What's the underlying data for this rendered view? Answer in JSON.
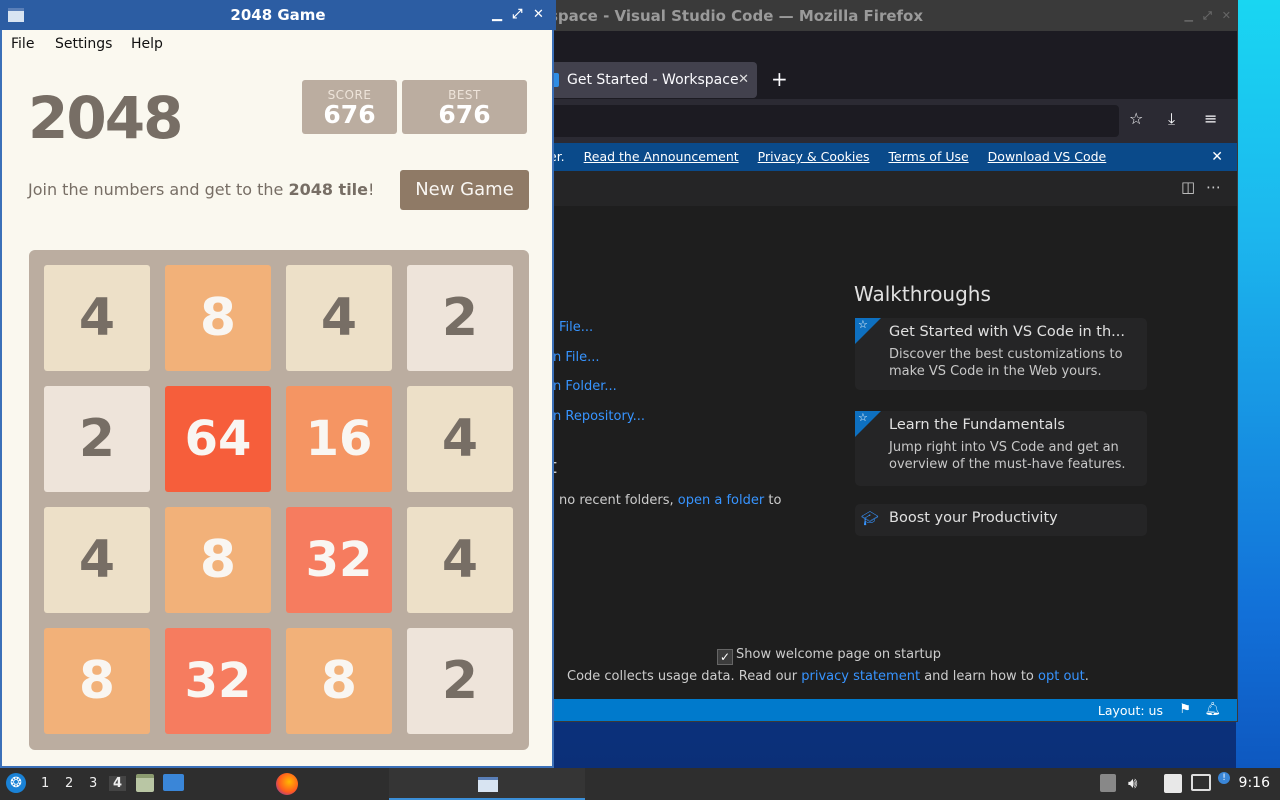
{
  "firefox": {
    "title": "space - Visual Studio Code — Mozilla Firefox",
    "tab_label": "Get Started - Workspace",
    "tab_close": "✕",
    "new_tab": "+",
    "banner": {
      "lead": "er.",
      "links": [
        "Read the Announcement",
        "Privacy & Cookies",
        "Terms of Use",
        "Download VS Code"
      ],
      "close": "✕"
    }
  },
  "vscode": {
    "start_links": [
      "File...",
      "n File...",
      "n Folder...",
      "n Repository..."
    ],
    "recent_heading": "t",
    "recent_text": "no recent folders,",
    "recent_link": "open a folder",
    "recent_tail": "to",
    "walkthroughs_heading": "Walkthroughs",
    "walkthroughs": [
      {
        "title": "Get Started with VS Code in th...",
        "description": "Discover the best customizations to make VS Code in the Web yours."
      },
      {
        "title": "Learn the Fundamentals",
        "description": "Jump right into VS Code and get an overview of the must-have features."
      },
      {
        "title": "Boost your Productivity",
        "description": ""
      }
    ],
    "show_welcome": "Show welcome page on startup",
    "usage_pre": "Code collects usage data. Read our",
    "usage_link1": "privacy statement",
    "usage_mid": "and learn how to",
    "usage_link2": "opt out",
    "usage_end": ".",
    "status_layout": "Layout: us"
  },
  "game_window": {
    "title": "2048 Game",
    "menu": [
      "File",
      "Settings",
      "Help"
    ],
    "heading": "2048",
    "score_label": "SCORE",
    "score": "676",
    "best_label": "BEST",
    "best": "676",
    "intro_pre": "Join the numbers and get to the",
    "intro_bold": "2048 tile",
    "intro_post": "!",
    "new_game": "New Game",
    "board": [
      [
        "4",
        "8",
        "4",
        "2"
      ],
      [
        "2",
        "64",
        "16",
        "4"
      ],
      [
        "4",
        "8",
        "32",
        "4"
      ],
      [
        "8",
        "32",
        "8",
        "2"
      ]
    ]
  },
  "taskbar": {
    "workspaces": [
      "1",
      "2",
      "3",
      "4"
    ],
    "active_workspace": "4",
    "clock": "9:16"
  }
}
